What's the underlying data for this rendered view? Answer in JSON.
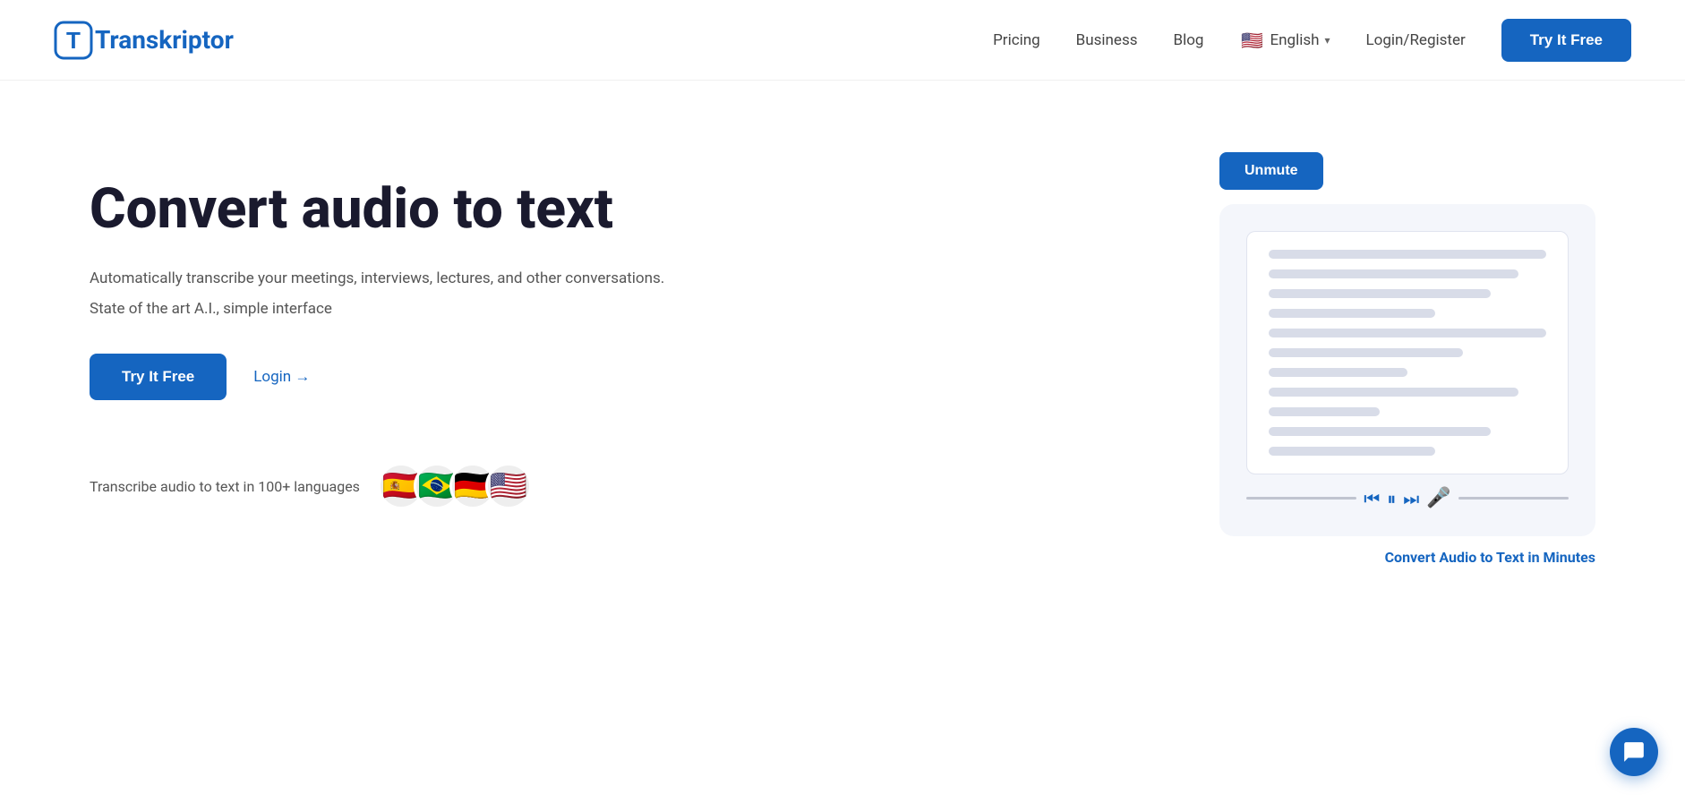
{
  "navbar": {
    "logo_letter": "T",
    "logo_brand": "ranskriptor",
    "links": [
      {
        "label": "Pricing",
        "id": "pricing"
      },
      {
        "label": "Business",
        "id": "business"
      },
      {
        "label": "Blog",
        "id": "blog"
      }
    ],
    "lang_flag": "🇺🇸",
    "lang_label": "English",
    "login_label": "Login/Register",
    "try_free_label": "Try It Free"
  },
  "hero": {
    "title": "Convert audio to text",
    "subtitle": "Automatically transcribe your meetings, interviews, lectures, and other conversations.",
    "subtitle2": "State of the art A.I., simple interface",
    "try_btn": "Try It Free",
    "login_link": "Login →",
    "languages_text": "Transcribe audio to text in 100+ languages",
    "flags": [
      "🇪🇸",
      "🇧🇷",
      "🇩🇪",
      "🇺🇸"
    ],
    "unmute_btn": "Unmute",
    "convert_label": "Convert Audio to Text in Minutes"
  }
}
